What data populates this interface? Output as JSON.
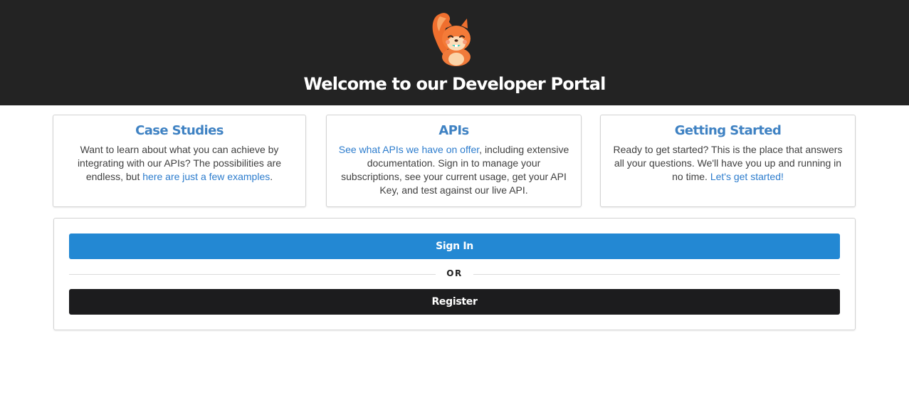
{
  "header": {
    "title": "Welcome to our Developer Portal",
    "logo_icon": "squirrel-mascot-icon",
    "background": "#232323"
  },
  "cards": [
    {
      "title": "Case Studies",
      "text_before": "Want to learn about what you can achieve by integrating with our APIs? The possibilities are endless, but ",
      "link": "here are just a few examples",
      "text_after": "."
    },
    {
      "title": "APIs",
      "text_before": "",
      "link": "See what APIs we have on offer",
      "text_after": ", including extensive documentation. Sign in to manage your subscriptions, see your current usage, get your API Key, and test against our live API."
    },
    {
      "title": "Getting Started",
      "text_before": "Ready to get started? This is the place that answers all your questions. We'll have you up and running in no time. ",
      "link": "Let's get started!",
      "text_after": ""
    }
  ],
  "auth": {
    "signin_label": "Sign In",
    "or_label": "OR",
    "register_label": "Register"
  },
  "colors": {
    "accent": "#2388d3",
    "link": "#2c7ccd",
    "heading": "#3f82c3",
    "dark_button": "#1c1c1e"
  }
}
